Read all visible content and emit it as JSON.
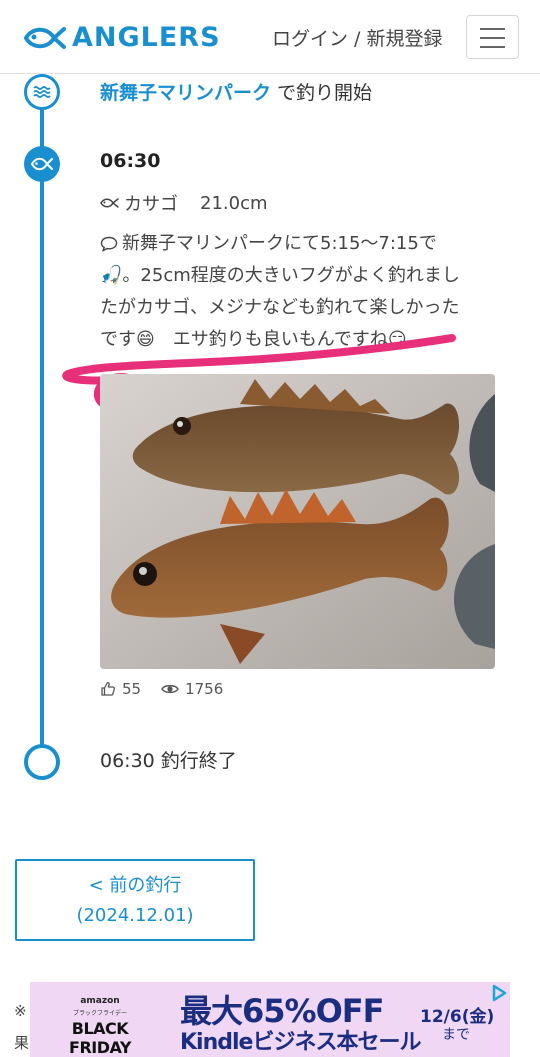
{
  "header": {
    "logo_text": "ANGLERS",
    "login_label": "ログイン / 新規登録"
  },
  "timeline": {
    "start": {
      "place": "新舞子マリンパーク",
      "suffix": " で釣り開始"
    },
    "catch": {
      "time": "06:30",
      "species": "カサゴ",
      "size": "21.0cm",
      "comment_line1": "新舞子マリンパークにて5:15〜7:15で",
      "comment_line2": "🎣。25cm程度の大きいフグがよく釣れまし",
      "comment_line3": "たがカサゴ、メジナなども釣れて楽しかった",
      "comment_line4": "です😄　エサ釣りも良いもんですね😏",
      "likes": "55",
      "views": "1756"
    },
    "end": {
      "label": "06:30 釣行終了"
    }
  },
  "prev_trip": {
    "label": "< 前の釣行",
    "date": "(2024.12.01)"
  },
  "note": {
    "line1": "※",
    "line2": "果"
  },
  "ad": {
    "brand": "amazon",
    "sub": "ブラックフライデー",
    "event": "BLACK FRIDAY",
    "headline": "最大65%OFF",
    "subline": "Kindleビジネス本セール",
    "date": "12/6(金)",
    "until": "まで"
  },
  "colors": {
    "accent": "#1a8fd0",
    "marker": "#e8307a",
    "ad_bg": "#f0d8f4"
  }
}
